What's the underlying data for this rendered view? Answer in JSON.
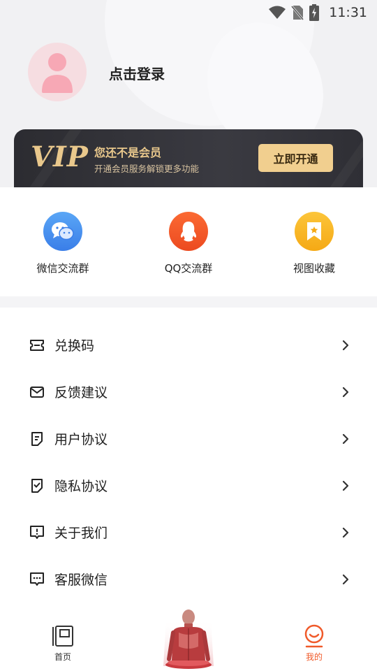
{
  "status_bar": {
    "time": "11:31"
  },
  "profile": {
    "login_text": "点击登录"
  },
  "vip": {
    "logo": "VIP",
    "title": "您还不是会员",
    "subtitle": "开通会员服务解锁更多功能",
    "button": "立即开通"
  },
  "quick_actions": [
    {
      "label": "微信交流群",
      "icon": "wechat-icon",
      "color": "#4a90f0"
    },
    {
      "label": "QQ交流群",
      "icon": "qq-icon",
      "color": "#f25a2a"
    },
    {
      "label": "视图收藏",
      "icon": "bookmark-icon",
      "color": "#f8b623"
    }
  ],
  "menu": [
    {
      "label": "兑换码",
      "icon": "ticket-icon"
    },
    {
      "label": "反馈建议",
      "icon": "mail-icon"
    },
    {
      "label": "用户协议",
      "icon": "document-icon"
    },
    {
      "label": "隐私协议",
      "icon": "shield-check-icon"
    },
    {
      "label": "关于我们",
      "icon": "info-chat-icon"
    },
    {
      "label": "客服微信",
      "icon": "chat-bubble-icon"
    }
  ],
  "bottom_nav": {
    "home": {
      "label": "首页",
      "icon": "book-icon"
    },
    "center": {
      "icon": "anatomy-figure-icon"
    },
    "mine": {
      "label": "我的",
      "icon": "user-smile-icon",
      "active_color": "#f05a2a"
    }
  }
}
